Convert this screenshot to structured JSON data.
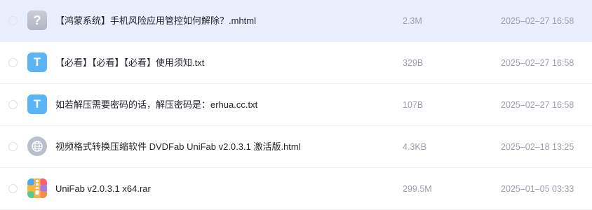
{
  "files": [
    {
      "icon": "unknown-file-icon",
      "icon_glyph": "?",
      "name": "【鸿蒙系统】手机风险应用管控如何解除？.mhtml",
      "size": "2.3M",
      "date": "2025–02–27 16:58",
      "selected": true
    },
    {
      "icon": "text-file-icon",
      "icon_glyph": "T",
      "name": "【必看】【必看】【必看】使用须知.txt",
      "size": "329B",
      "date": "2025–02–27 16:58",
      "selected": false
    },
    {
      "icon": "text-file-icon",
      "icon_glyph": "T",
      "name": "如若解压需要密码的话，解压密码是：erhua.cc.txt",
      "size": "107B",
      "date": "2025–02–27 16:58",
      "selected": false
    },
    {
      "icon": "web-file-icon",
      "icon_glyph": "",
      "name": "视频格式转换压缩软件 DVDFab UniFab v2.0.3.1 激活版.html",
      "size": "4.3KB",
      "date": "2025–02–18 13:25",
      "selected": false
    },
    {
      "icon": "archive-file-icon",
      "icon_glyph": "",
      "name": "UniFab v2.0.3.1 x64.rar",
      "size": "299.5M",
      "date": "2025–01–05 03:33",
      "selected": false
    }
  ],
  "colors": {
    "selected_row": "#e9effd",
    "txt_icon": "#5ab4f6",
    "unknown_icon": "#bfc3ce",
    "meta_text": "#9aa0ab"
  }
}
